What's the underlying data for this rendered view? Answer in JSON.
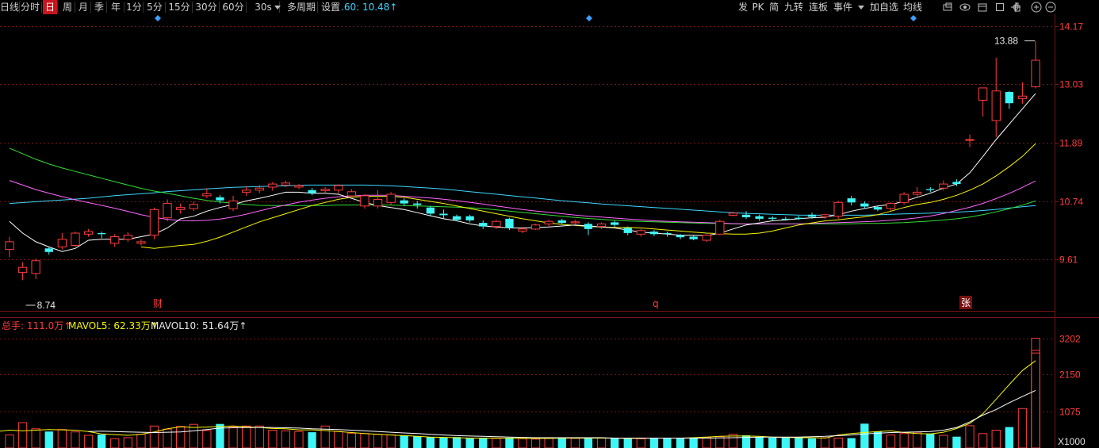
{
  "toolbar": {
    "items": [
      "日线",
      "分时",
      "日",
      "周",
      "月",
      "季",
      "年",
      "1分",
      "5分",
      "15分",
      "30分",
      "60分",
      "30s",
      "多周期",
      "设置"
    ],
    "selected": "日",
    "ma60_label": ".60: 10.48↑",
    "right_items": [
      "发",
      "PK",
      "简",
      "九转",
      "连板",
      "事件",
      "加自选",
      "均线"
    ],
    "right_icons": [
      "overlay-icon",
      "eye-icon",
      "calendar-icon",
      "square-icon",
      "hand-icon",
      "crosshair-icon",
      "zoom-in-icon",
      "zoom-out-icon"
    ]
  },
  "price_axis": {
    "ticks": [
      "14.17",
      "13.03",
      "11.89",
      "10.74",
      "9.61"
    ],
    "high_label": "13.88",
    "low_label": "8.74"
  },
  "markers": {
    "cai": "财",
    "q": "q",
    "zhang": "张"
  },
  "volume": {
    "total_label": "总手: 111.0万↑",
    "mavol5_label": "MAVOL5: 62.33万↑",
    "mavol10_label": "MAVOL10: 51.64万↑",
    "ticks": [
      "3202",
      "2150",
      "1075"
    ],
    "unit_label": "X1000"
  },
  "colors": {
    "up": "#ff3b3b",
    "down": "#3ef6f6",
    "grid": "#7a1414",
    "ma5": "#ffffff",
    "ma10": "#f7f700",
    "ma20": "#ff66ff",
    "ma30": "#33dd33",
    "ma60": "#3dd6ff",
    "accent": "#c8141e"
  },
  "chart_data": {
    "type": "candlestick",
    "ylim": [
      8.6,
      14.4
    ],
    "candles": [
      [
        9.8,
        9.95,
        9.65,
        10.05
      ],
      [
        9.35,
        9.45,
        9.2,
        9.55
      ],
      [
        9.33,
        9.58,
        9.22,
        9.62
      ],
      [
        9.82,
        9.75,
        9.7,
        9.84
      ],
      [
        9.85,
        10.0,
        9.8,
        10.12
      ],
      [
        9.88,
        10.12,
        9.85,
        10.15
      ],
      [
        10.1,
        10.15,
        10.05,
        10.2
      ],
      [
        10.12,
        10.1,
        10.02,
        10.15
      ],
      [
        9.92,
        10.05,
        9.85,
        10.1
      ],
      [
        10.0,
        10.08,
        9.95,
        10.14
      ],
      [
        9.92,
        9.95,
        9.88,
        10.0
      ],
      [
        10.08,
        10.58,
        10.0,
        10.62
      ],
      [
        10.42,
        10.7,
        10.35,
        10.78
      ],
      [
        10.58,
        10.62,
        10.5,
        10.7
      ],
      [
        10.6,
        10.68,
        10.55,
        10.74
      ],
      [
        10.85,
        10.89,
        10.8,
        11.0
      ],
      [
        10.82,
        10.76,
        10.7,
        10.86
      ],
      [
        10.6,
        10.75,
        10.55,
        10.85
      ],
      [
        10.92,
        10.96,
        10.85,
        11.04
      ],
      [
        10.96,
        11.0,
        10.9,
        11.06
      ],
      [
        11.02,
        11.08,
        10.95,
        11.12
      ],
      [
        11.06,
        11.1,
        11.02,
        11.15
      ],
      [
        11.02,
        11.05,
        10.98,
        11.08
      ],
      [
        10.96,
        10.9,
        10.86,
        11.0
      ],
      [
        10.95,
        10.98,
        10.9,
        11.02
      ],
      [
        10.96,
        11.05,
        10.9,
        11.07
      ],
      [
        10.85,
        10.93,
        10.8,
        10.98
      ],
      [
        10.65,
        10.85,
        10.6,
        10.88
      ],
      [
        10.65,
        10.78,
        10.6,
        10.96
      ],
      [
        10.72,
        10.88,
        10.68,
        10.92
      ],
      [
        10.76,
        10.7,
        10.65,
        10.8
      ],
      [
        10.7,
        10.67,
        10.6,
        10.75
      ],
      [
        10.62,
        10.5,
        10.45,
        10.65
      ],
      [
        10.5,
        10.47,
        10.4,
        10.58
      ],
      [
        10.45,
        10.38,
        10.35,
        10.48
      ],
      [
        10.45,
        10.37,
        10.33,
        10.48
      ],
      [
        10.32,
        10.25,
        10.2,
        10.37
      ],
      [
        10.25,
        10.35,
        10.2,
        10.38
      ],
      [
        10.4,
        10.22,
        10.18,
        10.42
      ],
      [
        10.16,
        10.2,
        10.12,
        10.24
      ],
      [
        10.2,
        10.28,
        10.18,
        10.3
      ],
      [
        10.3,
        10.35,
        10.25,
        10.38
      ],
      [
        10.37,
        10.32,
        10.3,
        10.4
      ],
      [
        10.32,
        10.34,
        10.3,
        10.38
      ],
      [
        10.3,
        10.2,
        10.08,
        10.33
      ],
      [
        10.25,
        10.3,
        10.2,
        10.33
      ],
      [
        10.33,
        10.28,
        10.24,
        10.36
      ],
      [
        10.22,
        10.12,
        10.08,
        10.25
      ],
      [
        10.1,
        10.17,
        10.05,
        10.2
      ],
      [
        10.15,
        10.1,
        10.06,
        10.18
      ],
      [
        10.12,
        10.1,
        10.05,
        10.15
      ],
      [
        10.08,
        10.04,
        10.0,
        10.1
      ],
      [
        10.05,
        10.0,
        9.98,
        10.08
      ],
      [
        9.98,
        10.08,
        9.95,
        10.1
      ],
      [
        10.1,
        10.35,
        10.08,
        10.38
      ],
      [
        10.47,
        10.51,
        10.45,
        10.54
      ],
      [
        10.48,
        10.43,
        10.4,
        10.55
      ],
      [
        10.45,
        10.4,
        10.36,
        10.48
      ],
      [
        10.42,
        10.4,
        10.36,
        10.45
      ],
      [
        10.4,
        10.39,
        10.36,
        10.44
      ],
      [
        10.42,
        10.4,
        10.38,
        10.46
      ],
      [
        10.48,
        10.44,
        10.4,
        10.52
      ],
      [
        10.44,
        10.48,
        10.4,
        10.5
      ],
      [
        10.45,
        10.72,
        10.4,
        10.75
      ],
      [
        10.8,
        10.72,
        10.66,
        10.85
      ],
      [
        10.7,
        10.64,
        10.6,
        10.74
      ],
      [
        10.63,
        10.58,
        10.55,
        10.66
      ],
      [
        10.6,
        10.7,
        10.56,
        10.72
      ],
      [
        10.72,
        10.88,
        10.68,
        10.92
      ],
      [
        10.88,
        10.92,
        10.84,
        11.02
      ],
      [
        10.98,
        10.96,
        10.92,
        11.02
      ],
      [
        11.0,
        11.08,
        10.95,
        11.15
      ],
      [
        11.12,
        11.08,
        11.04,
        11.17
      ],
      [
        11.95,
        11.95,
        11.8,
        12.05
      ],
      [
        12.72,
        12.96,
        12.4,
        12.96
      ],
      [
        12.32,
        12.9,
        12.0,
        13.55
      ],
      [
        12.88,
        12.66,
        12.55,
        12.9
      ],
      [
        12.75,
        12.8,
        12.65,
        13.07
      ],
      [
        12.98,
        13.5,
        12.95,
        13.88
      ]
    ],
    "ma5": [
      10.35,
      10.12,
      9.95,
      9.85,
      9.76,
      9.82,
      9.98,
      10.0,
      10.0,
      10.0,
      10.05,
      10.1,
      10.22,
      10.4,
      10.45,
      10.55,
      10.62,
      10.68,
      10.75,
      10.8,
      10.86,
      10.92,
      10.92,
      10.9,
      10.9,
      10.88,
      10.8,
      10.72,
      10.66,
      10.62,
      10.58,
      10.52,
      10.46,
      10.4,
      10.36,
      10.3,
      10.26,
      10.24,
      10.22,
      10.22,
      10.23,
      10.24,
      10.26,
      10.28,
      10.26,
      10.24,
      10.22,
      10.18,
      10.14,
      10.12,
      10.1,
      10.08,
      10.08,
      10.07,
      10.12,
      10.2,
      10.28,
      10.32,
      10.36,
      10.38,
      10.4,
      10.42,
      10.43,
      10.48,
      10.55,
      10.6,
      10.65,
      10.68,
      10.74,
      10.82,
      10.9,
      11.0,
      11.08,
      11.3,
      11.62,
      11.95,
      12.25,
      12.55,
      12.85
    ],
    "ma10": [
      null,
      null,
      null,
      null,
      null,
      null,
      9.85,
      9.82,
      9.85,
      9.88,
      9.9,
      9.96,
      10.04,
      10.14,
      10.24,
      10.34,
      10.42,
      10.5,
      10.58,
      10.66,
      10.72,
      10.78,
      10.82,
      10.84,
      10.84,
      10.84,
      10.82,
      10.78,
      10.74,
      10.7,
      10.65,
      10.6,
      10.55,
      10.5,
      10.45,
      10.4,
      10.36,
      10.32,
      10.29,
      10.27,
      10.25,
      10.24,
      10.23,
      10.23,
      10.22,
      10.2,
      10.18,
      10.16,
      10.14,
      10.12,
      10.11,
      10.1,
      10.1,
      10.12,
      10.16,
      10.22,
      10.28,
      10.32,
      10.36,
      10.38,
      10.41,
      10.44,
      10.48,
      10.55,
      10.62,
      10.68,
      10.72,
      10.78,
      10.86,
      10.96,
      11.08,
      11.24,
      11.42,
      11.62,
      11.87
    ],
    "ma20": [
      11.15,
      11.05,
      10.95,
      10.88,
      10.8,
      10.74,
      10.68,
      10.62,
      10.55,
      10.48,
      10.42,
      10.38,
      10.36,
      10.36,
      10.38,
      10.42,
      10.48,
      10.55,
      10.62,
      10.68,
      10.74,
      10.78,
      10.82,
      10.84,
      10.86,
      10.86,
      10.86,
      10.84,
      10.82,
      10.8,
      10.77,
      10.74,
      10.7,
      10.66,
      10.62,
      10.58,
      10.55,
      10.52,
      10.49,
      10.46,
      10.44,
      10.42,
      10.4,
      10.38,
      10.36,
      10.35,
      10.34,
      10.33,
      10.32,
      10.31,
      10.3,
      10.3,
      10.3,
      10.3,
      10.3,
      10.31,
      10.32,
      10.33,
      10.34,
      10.35,
      10.37,
      10.39,
      10.42,
      10.46,
      10.52,
      10.59,
      10.66,
      10.76,
      10.87,
      11.0,
      11.14
    ],
    "ma30": [
      11.78,
      11.65,
      11.52,
      11.42,
      11.34,
      11.26,
      11.18,
      11.1,
      11.02,
      10.95,
      10.9,
      10.84,
      10.78,
      10.74,
      10.71,
      10.68,
      10.66,
      10.66,
      10.66,
      10.66,
      10.66,
      10.67,
      10.67,
      10.67,
      10.67,
      10.66,
      10.65,
      10.64,
      10.63,
      10.62,
      10.6,
      10.57,
      10.54,
      10.51,
      10.48,
      10.45,
      10.42,
      10.4,
      10.38,
      10.36,
      10.35,
      10.34,
      10.33,
      10.32,
      10.31,
      10.31,
      10.3,
      10.3,
      10.3,
      10.3,
      10.3,
      10.3,
      10.3,
      10.3,
      10.31,
      10.31,
      10.32,
      10.33,
      10.35,
      10.37,
      10.4,
      10.44,
      10.5,
      10.57,
      10.65,
      10.75
    ],
    "ma60": [
      10.7,
      10.72,
      10.74,
      10.76,
      10.78,
      10.8,
      10.83,
      10.86,
      10.88,
      10.9,
      10.93,
      10.95,
      10.97,
      10.99,
      11.01,
      11.02,
      11.03,
      11.04,
      11.05,
      11.06,
      11.06,
      11.06,
      11.06,
      11.06,
      11.05,
      11.04,
      11.02,
      11.0,
      10.98,
      10.95,
      10.92,
      10.89,
      10.86,
      10.83,
      10.8,
      10.77,
      10.74,
      10.72,
      10.69,
      10.67,
      10.65,
      10.63,
      10.61,
      10.59,
      10.57,
      10.55,
      10.53,
      10.51,
      10.5,
      10.49,
      10.48,
      10.47,
      10.47,
      10.47,
      10.47,
      10.47,
      10.48,
      10.49,
      10.5,
      10.51,
      10.52,
      10.53,
      10.55,
      10.57,
      10.6,
      10.63,
      10.66
    ],
    "volume": [
      380,
      740,
      560,
      480,
      540,
      470,
      370,
      390,
      270,
      300,
      400,
      640,
      550,
      630,
      690,
      510,
      700,
      620,
      640,
      640,
      520,
      500,
      480,
      460,
      640,
      480,
      430,
      420,
      400,
      380,
      360,
      340,
      320,
      300,
      320,
      300,
      280,
      280,
      300,
      270,
      260,
      280,
      290,
      280,
      300,
      290,
      280,
      280,
      270,
      280,
      300,
      280,
      290,
      300,
      330,
      400,
      370,
      320,
      300,
      320,
      300,
      280,
      300,
      290,
      290,
      710,
      480,
      380,
      420,
      460,
      420,
      370,
      330,
      650,
      420,
      520,
      610,
      1150,
      3202,
      2850,
      2280,
      2100,
      2770
    ],
    "mavol5": [
      480,
      520,
      500,
      520,
      540,
      530,
      520,
      480,
      410,
      390,
      370,
      400,
      470,
      560,
      620,
      600,
      610,
      630,
      640,
      620,
      600,
      570,
      560,
      530,
      530,
      510,
      480,
      450,
      420,
      400,
      380,
      360,
      340,
      320,
      310,
      300,
      290,
      290,
      290,
      280,
      280,
      280,
      280,
      290,
      290,
      290,
      290,
      290,
      280,
      285,
      290,
      290,
      290,
      300,
      320,
      340,
      350,
      350,
      340,
      320,
      310,
      300,
      300,
      290,
      380,
      420,
      450,
      480,
      500,
      450,
      420,
      410,
      460,
      570,
      720,
      1000,
      1420,
      1850,
      2260,
      2550
    ],
    "mavol10": [
      null,
      null,
      null,
      null,
      null,
      null,
      480,
      490,
      480,
      470,
      460,
      450,
      460,
      470,
      500,
      540,
      580,
      590,
      600,
      600,
      600,
      590,
      580,
      560,
      550,
      540,
      520,
      500,
      480,
      460,
      440,
      420,
      400,
      380,
      360,
      350,
      340,
      330,
      320,
      310,
      300,
      300,
      300,
      300,
      300,
      300,
      290,
      290,
      290,
      290,
      290,
      290,
      290,
      290,
      295,
      300,
      310,
      320,
      320,
      320,
      320,
      330,
      340,
      360,
      380,
      410,
      430,
      450,
      460,
      470,
      480,
      520,
      600,
      760,
      960,
      1120,
      1320,
      1500,
      1680
    ]
  }
}
